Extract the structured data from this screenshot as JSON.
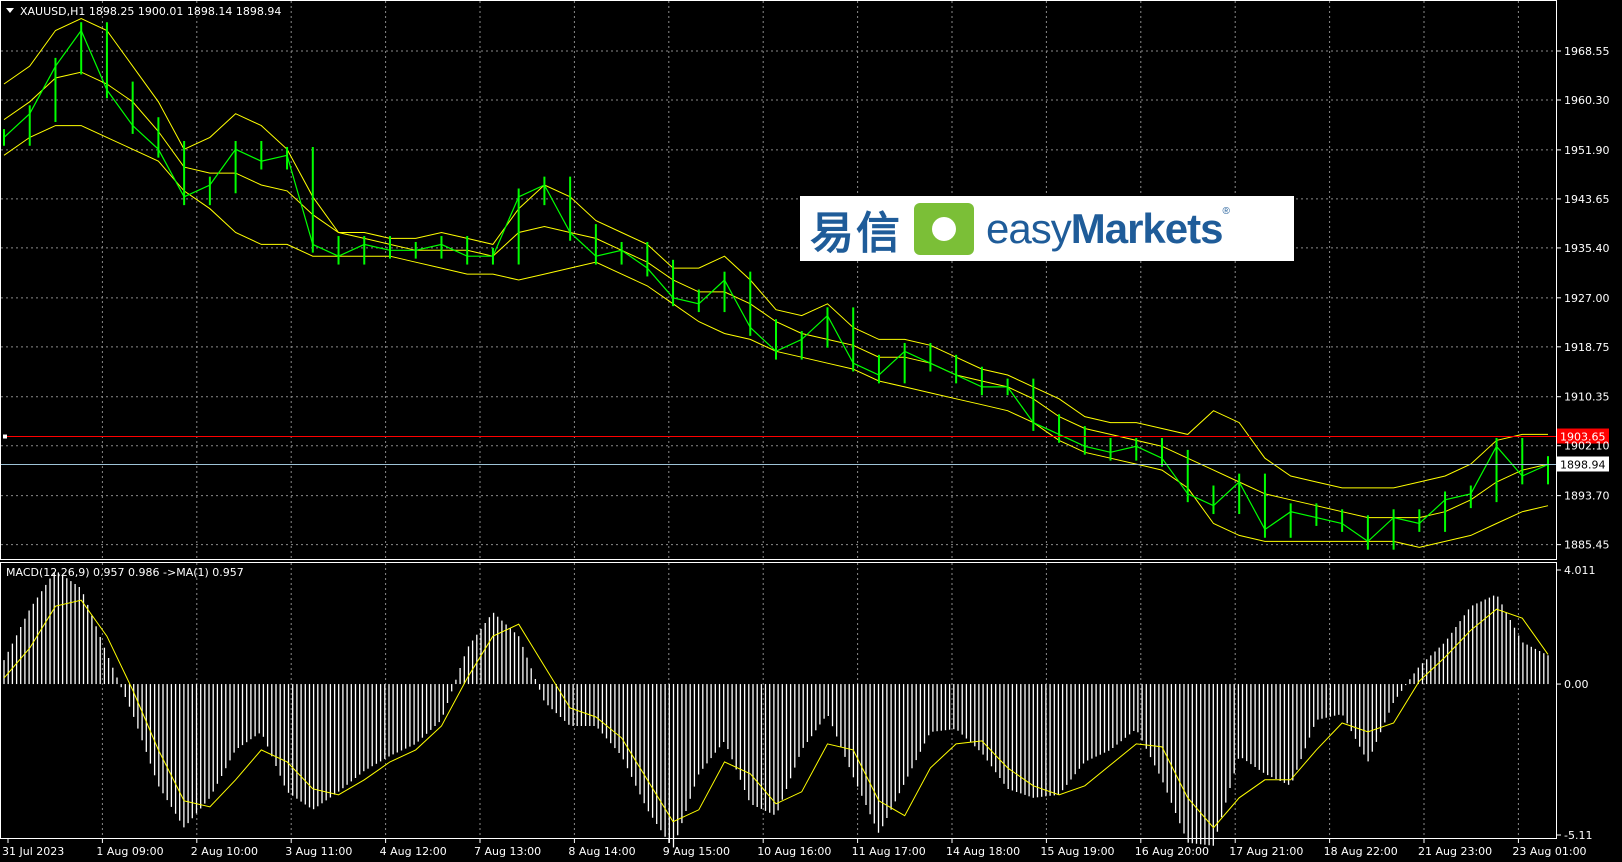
{
  "header": {
    "symbol_line": "XAUUSD,H1  1898.25 1900.01 1898.14 1898.94"
  },
  "logo": {
    "chinese": "易信",
    "brand_light": "easy",
    "brand_bold": "Markets",
    "registered": "®"
  },
  "colors": {
    "background": "#000000",
    "grid": "#8a8a8a",
    "candle": "#00ff00",
    "bands": "#ffff00",
    "alert_line": "#ff0000",
    "price_line": "#9ec3d6",
    "histogram": "#ffffff",
    "signal": "#ffff00",
    "logo_blue": "#1f5c99",
    "logo_green": "#7bbf37"
  },
  "chart_data": [
    {
      "type": "line",
      "name": "price",
      "title": "XAUUSD,H1  1898.25 1900.01 1898.14 1898.94",
      "xlabel": "",
      "ylabel": "",
      "ylim": [
        1883.2,
        1976.8
      ],
      "y_ticks": [
        1968.55,
        1960.3,
        1951.9,
        1943.65,
        1935.4,
        1927.0,
        1918.75,
        1910.35,
        1902.1,
        1893.7,
        1885.45
      ],
      "y_tick_labels": [
        "1968.55",
        "1960.30",
        "1951.90",
        "1943.65",
        "1935.40",
        "1927.00",
        "1918.75",
        "1910.35",
        "1902.10",
        "1893.70",
        "1885.45"
      ],
      "x_tick_labels": [
        "31 Jul 2023",
        "1 Aug 09:00",
        "2 Aug 10:00",
        "3 Aug 11:00",
        "4 Aug 12:00",
        "7 Aug 13:00",
        "8 Aug 14:00",
        "9 Aug 15:00",
        "10 Aug 16:00",
        "11 Aug 17:00",
        "14 Aug 18:00",
        "15 Aug 19:00",
        "16 Aug 20:00",
        "17 Aug 21:00",
        "18 Aug 22:00",
        "21 Aug 23:00",
        "23 Aug 01:00"
      ],
      "grid": true,
      "alert_level": {
        "value": 1903.65,
        "label": "1903.65"
      },
      "current_price": {
        "value": 1898.94,
        "label": "1898.94"
      },
      "series": [
        {
          "values": [
            1954,
            1958,
            1966,
            1972,
            1962,
            1956,
            1952,
            1944,
            1946,
            1952,
            1950,
            1951,
            1936,
            1934,
            1936,
            1935,
            1935,
            1936,
            1934,
            1934,
            1944,
            1946,
            1938,
            1934,
            1935,
            1932,
            1927,
            1926,
            1930,
            1922,
            1918,
            1920,
            1924,
            1916,
            1914,
            1918,
            1916,
            1914,
            1912,
            1912,
            1906,
            1904,
            1902,
            1901,
            1902,
            1900,
            1894,
            1892,
            1896,
            1888,
            1891,
            1890,
            1889,
            1886,
            1890,
            1889,
            1893,
            1894,
            1902,
            1897,
            1898.94
          ]
        },
        {
          "name": "upper band",
          "values": [
            1963,
            1966,
            1972,
            1974,
            1972,
            1966,
            1960,
            1952,
            1954,
            1958,
            1956,
            1952,
            1944,
            1938,
            1938,
            1937,
            1937,
            1938,
            1937,
            1936,
            1942,
            1946,
            1944,
            1940,
            1938,
            1936,
            1932,
            1932,
            1934,
            1930,
            1925,
            1924,
            1926,
            1922,
            1920,
            1920,
            1919,
            1917,
            1915,
            1914,
            1912,
            1910,
            1907,
            1906,
            1906,
            1905,
            1904,
            1908,
            1906,
            1900,
            1897,
            1896,
            1895,
            1895,
            1895,
            1896,
            1897,
            1899,
            1903,
            1904,
            1904
          ]
        },
        {
          "name": "middle band",
          "values": [
            1957,
            1960,
            1964,
            1965,
            1963,
            1960,
            1955,
            1949,
            1948,
            1948,
            1946,
            1945,
            1941,
            1938,
            1937,
            1936,
            1935,
            1935,
            1935,
            1934,
            1938,
            1939,
            1938,
            1937,
            1935,
            1933,
            1930,
            1928,
            1928,
            1926,
            1923,
            1921,
            1920,
            1919,
            1917,
            1917,
            1916,
            1914,
            1913,
            1912,
            1910,
            1907,
            1905,
            1904,
            1903,
            1902,
            1900,
            1898,
            1896,
            1894,
            1893,
            1892,
            1891,
            1890,
            1890,
            1890,
            1891,
            1893,
            1896,
            1898,
            1899
          ]
        },
        {
          "name": "lower band",
          "values": [
            1951,
            1954,
            1956,
            1956,
            1954,
            1952,
            1950,
            1945,
            1942,
            1938,
            1936,
            1936,
            1934,
            1934,
            1934,
            1934,
            1933,
            1932,
            1931,
            1931,
            1930,
            1931,
            1932,
            1933,
            1931,
            1929,
            1926,
            1923,
            1921,
            1920,
            1918,
            1917,
            1916,
            1915,
            1913,
            1912,
            1911,
            1910,
            1909,
            1908,
            1906,
            1903,
            1901,
            1900,
            1899,
            1898,
            1895,
            1889,
            1887,
            1886,
            1886,
            1886,
            1886,
            1886,
            1886,
            1885,
            1886,
            1887,
            1889,
            1891,
            1892
          ]
        }
      ]
    },
    {
      "type": "bar",
      "name": "macd",
      "title": "MACD(12,26,9) 0.957 0.986  ->MA(1) 0.957",
      "xlabel": "",
      "ylabel": "",
      "ylim": [
        -5.11,
        4.011
      ],
      "y_ticks": [
        4.011,
        0.0,
        -5.11
      ],
      "y_tick_labels": [
        "4.011",
        "0.00",
        "-5.11"
      ],
      "grid": true,
      "series": [
        {
          "name": "histogram",
          "values": [
            0.8,
            2.5,
            3.8,
            3.2,
            1.0,
            -1.0,
            -3.4,
            -4.8,
            -3.8,
            -2.2,
            -1.6,
            -3.6,
            -4.2,
            -3.6,
            -2.9,
            -2.4,
            -2.0,
            -1.2,
            1.2,
            2.4,
            1.6,
            -0.6,
            -1.4,
            -1.4,
            -2.4,
            -4.2,
            -5.5,
            -3.0,
            -1.9,
            -4.0,
            -4.4,
            -2.2,
            -1.0,
            -3.1,
            -5.0,
            -3.3,
            -1.6,
            -1.5,
            -2.3,
            -3.5,
            -3.8,
            -3.7,
            -2.6,
            -2.2,
            -1.5,
            -3.2,
            -5.3,
            -5.4,
            -2.4,
            -3.0,
            -3.4,
            -1.2,
            -1.0,
            -2.6,
            -0.6,
            0.6,
            1.4,
            2.6,
            3.0,
            1.4,
            0.96
          ]
        },
        {
          "name": "signal",
          "values": [
            0.2,
            1.2,
            2.6,
            2.8,
            1.6,
            -0.2,
            -2.2,
            -3.9,
            -4.1,
            -3.2,
            -2.2,
            -2.6,
            -3.5,
            -3.7,
            -3.2,
            -2.6,
            -2.2,
            -1.4,
            0.2,
            1.6,
            2.0,
            0.6,
            -0.8,
            -1.1,
            -1.8,
            -3.2,
            -4.6,
            -4.2,
            -2.6,
            -3.0,
            -4.0,
            -3.6,
            -2.0,
            -2.2,
            -3.9,
            -4.4,
            -2.8,
            -2.0,
            -1.9,
            -2.8,
            -3.4,
            -3.7,
            -3.4,
            -2.7,
            -2.0,
            -2.1,
            -3.8,
            -4.8,
            -3.8,
            -3.2,
            -3.2,
            -2.2,
            -1.3,
            -1.6,
            -1.3,
            0.1,
            0.9,
            1.8,
            2.5,
            2.2,
            0.99
          ]
        }
      ]
    }
  ]
}
